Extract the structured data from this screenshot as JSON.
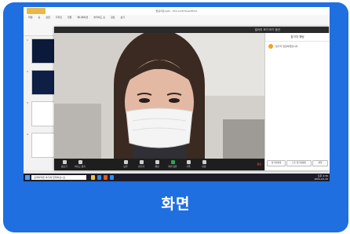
{
  "caption": "화면",
  "ppt": {
    "title": "발표자료.pptx - Microsoft PowerPoint",
    "tabs": [
      "파일",
      "홈",
      "삽입",
      "디자인",
      "전환",
      "애니메이션",
      "슬라이드 쇼",
      "검토",
      "보기"
    ],
    "thumbs": [
      "1",
      "2",
      "3",
      "4"
    ]
  },
  "zoom": {
    "title_right": "갤러리 보기   보기 옵션",
    "chat_header": "참가자 채팅",
    "chat_message": "참가자 입장하였습니다",
    "chat_buttons": [
      "참가자에게",
      "모든 참가자에게",
      "파일"
    ],
    "controls": [
      "음소거",
      "비디오 중지",
      "보안",
      "참가자",
      "채팅",
      "화면 공유",
      "기록",
      "반응"
    ],
    "end_label": "종료"
  },
  "taskbar": {
    "search_placeholder": "검색하려면 여기에 입력하십시오",
    "time": "오후 2:30",
    "date": "2021-03-15"
  },
  "colors": {
    "card": "#1f6fe0",
    "video_bg": "#c9c6c1",
    "record": "#2ea44f"
  }
}
